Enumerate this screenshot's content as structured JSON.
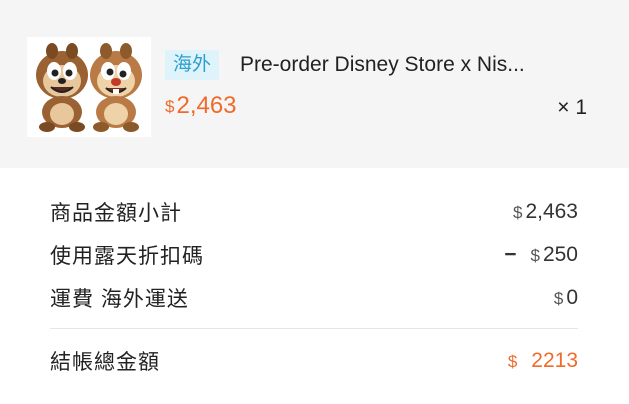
{
  "product": {
    "tag": "海外",
    "name": "Pre-order Disney Store x Nis...",
    "currency": "$",
    "price": "2,463",
    "quantity": "× 1"
  },
  "summary": {
    "subtotal_label": "商品金額小計",
    "subtotal_currency": "$",
    "subtotal_value": "2,463",
    "discount_label": "使用露天折扣碼",
    "discount_sign": "−",
    "discount_currency": "$",
    "discount_value": "250",
    "shipping_label": "運費 海外運送",
    "shipping_currency": "$",
    "shipping_value": "0",
    "total_label": "結帳總金額",
    "total_currency": "$",
    "total_value": "2213"
  },
  "colors": {
    "accent": "#ef6b2c",
    "tag_bg": "#dff3fb",
    "tag_text": "#2b9fd0",
    "product_bg": "#f5f5f5"
  }
}
